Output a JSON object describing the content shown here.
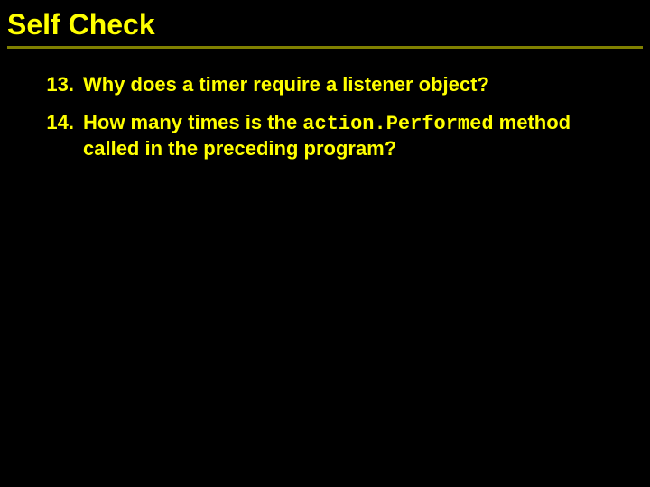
{
  "title": "Self Check",
  "items": [
    {
      "num": "13.",
      "text": "Why does a timer require a listener object?"
    },
    {
      "num": "14.",
      "pre": "How many times is the ",
      "code": "action.Performed",
      "post": " method called in the preceding program?"
    }
  ]
}
